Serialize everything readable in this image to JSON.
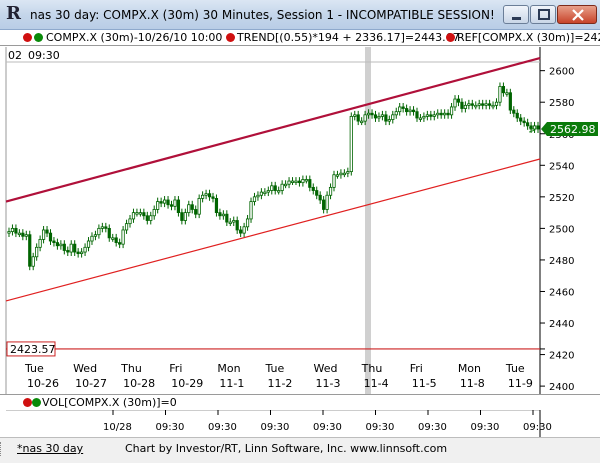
{
  "window": {
    "title": "nas 30 day: COMPX.X (30m) 30 Minutes, Session 1 - INCOMPATIBLE SESSION!",
    "logo": "R"
  },
  "infobar": {
    "symbol": "COMPX.X (30m)-10/26/10 10:00",
    "trend": "TREND[(0.55)*194 + 2336.17]=2443.67",
    "ref": "REF[COMPX.X (30m)]=242"
  },
  "time_header": {
    "left_fragment": "02",
    "time": "09:30"
  },
  "price_axis": {
    "labels": [
      "2600",
      "2580",
      "2560",
      "2540",
      "2520",
      "2500",
      "2480",
      "2460",
      "2440",
      "2420",
      "2400"
    ],
    "last_price": "2562.98",
    "ref_price": "2423.57"
  },
  "date_axis": {
    "days": [
      {
        "dow": "Tue",
        "date": "10-26"
      },
      {
        "dow": "Wed",
        "date": "10-27"
      },
      {
        "dow": "Thu",
        "date": "10-28"
      },
      {
        "dow": "Fri",
        "date": "10-29"
      },
      {
        "dow": "Mon",
        "date": "11-1"
      },
      {
        "dow": "Tue",
        "date": "11-2"
      },
      {
        "dow": "Wed",
        "date": "11-3"
      },
      {
        "dow": "Thu",
        "date": "11-4"
      },
      {
        "dow": "Fri",
        "date": "11-5"
      },
      {
        "dow": "Mon",
        "date": "11-8"
      },
      {
        "dow": "Tue",
        "date": "11-9"
      }
    ]
  },
  "volume": {
    "label": "VOL[COMPX.X (30m)]=0",
    "x_labels": [
      "10/28",
      "09:30",
      "09:30",
      "09:30",
      "09:30",
      "09:30",
      "09:30",
      "09:30",
      "09:30"
    ]
  },
  "statusbar": {
    "left": "*nas 30 day",
    "center": "Chart by Investor/RT, Linn Software, Inc. www.linnsoft.com"
  },
  "colors": {
    "candle": "#006400",
    "trend_upper": "#b0103a",
    "trend_lower": "#e02020",
    "ref_line": "#cc2020",
    "last_price_box": "#0a7a0a",
    "session_gap": "#d0d0d0"
  },
  "chart_data": {
    "type": "candlestick",
    "y_axis_range": [
      2395,
      2615
    ],
    "reference_level": 2423.57,
    "last_price": 2562.98,
    "trend_channel": {
      "upper": {
        "start": 2517,
        "end": 2608
      },
      "lower": {
        "start": 2454,
        "end": 2544
      }
    },
    "days": [
      "10-26",
      "10-27",
      "10-28",
      "10-29",
      "11-1",
      "11-2",
      "11-3",
      "11-4",
      "11-5",
      "11-8",
      "11-9"
    ],
    "closes": [
      2498,
      2500,
      2497,
      2497,
      2495,
      2496,
      2476,
      2482,
      2488,
      2493,
      2499,
      2497,
      2492,
      2491,
      2489,
      2490,
      2486,
      2485,
      2490,
      2485,
      2484,
      2485,
      2488,
      2492,
      2495,
      2496,
      2500,
      2501,
      2500,
      2494,
      2494,
      2491,
      2490,
      2499,
      2503,
      2506,
      2510,
      2510,
      2510,
      2508,
      2505,
      2508,
      2512,
      2517,
      2516,
      2518,
      2515,
      2514,
      2518,
      2510,
      2505,
      2510,
      2515,
      2512,
      2509,
      2519,
      2521,
      2522,
      2520,
      2519,
      2510,
      2508,
      2509,
      2504,
      2504,
      2505,
      2499,
      2497,
      2501,
      2506,
      2517,
      2520,
      2521,
      2523,
      2523,
      2524,
      2527,
      2524,
      2524,
      2528,
      2528,
      2530,
      2530,
      2530,
      2529,
      2531,
      2531,
      2526,
      2524,
      2521,
      2518,
      2512,
      2521,
      2526,
      2534,
      2534,
      2535,
      2535,
      2536,
      2571,
      2572,
      2568,
      2568,
      2572,
      2573,
      2572,
      2570,
      2571,
      2572,
      2568,
      2569,
      2572,
      2574,
      2577,
      2576,
      2574,
      2575,
      2574,
      2570,
      2570,
      2571,
      2572,
      2571,
      2572,
      2573,
      2572,
      2573,
      2572,
      2577,
      2582,
      2580,
      2576,
      2578,
      2579,
      2578,
      2578,
      2579,
      2578,
      2579,
      2578,
      2578,
      2580,
      2590,
      2586,
      2586,
      2575,
      2573,
      2570,
      2568,
      2567,
      2565,
      2563,
      2565,
      2563
    ]
  }
}
